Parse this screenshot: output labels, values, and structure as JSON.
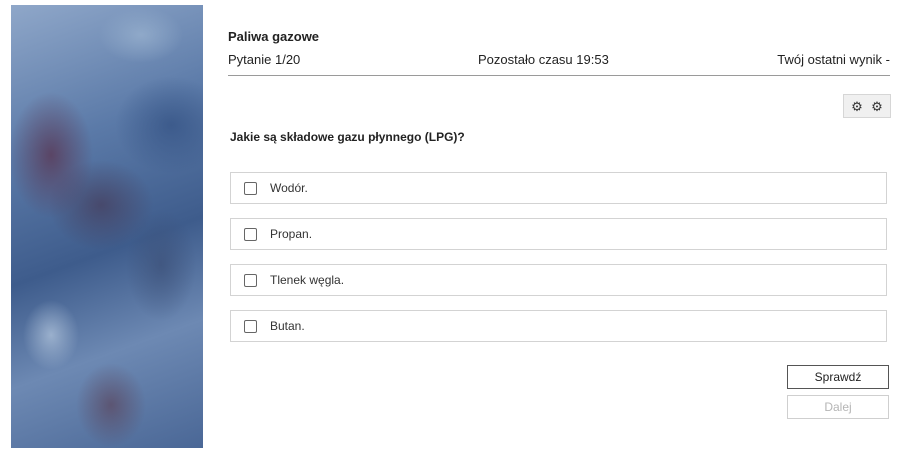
{
  "quiz": {
    "title": "Paliwa gazowe",
    "question_counter": "Pytanie 1/20",
    "time_remaining": "Pozostało czasu 19:53",
    "last_score": "Twój ostatni wynik -"
  },
  "settings": {
    "icons": [
      "gear-icon",
      "gear-icon"
    ],
    "glyph": "⚙"
  },
  "question": {
    "text": "Jakie są składowe gazu płynnego (LPG)?",
    "answers": [
      {
        "label": "Wodór.",
        "checked": false
      },
      {
        "label": "Propan.",
        "checked": false
      },
      {
        "label": "Tlenek węgla.",
        "checked": false
      },
      {
        "label": "Butan.",
        "checked": false
      }
    ]
  },
  "buttons": {
    "check_label": "Sprawdź",
    "next_label": "Dalej",
    "next_enabled": false
  }
}
